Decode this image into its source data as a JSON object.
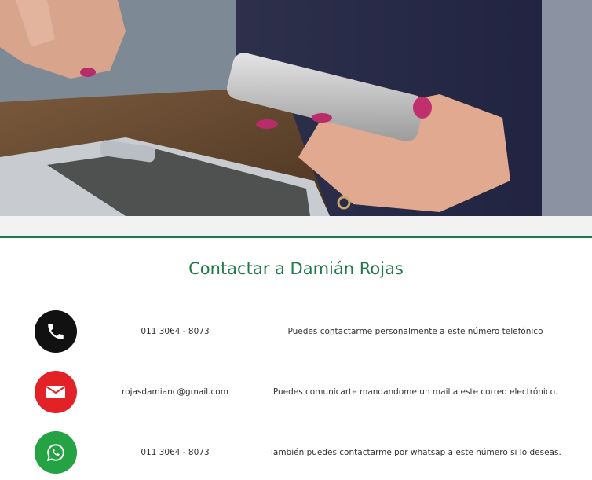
{
  "title": "Contactar a Damián Rojas",
  "colors": {
    "accent": "#1f7a48",
    "phone": "#111111",
    "mail": "#e32227",
    "whatsapp": "#25a244"
  },
  "contacts": [
    {
      "icon": "phone-icon",
      "value": "011 3064 - 8073",
      "description": "Puedes contactarme personalmente a este número telefónico"
    },
    {
      "icon": "mail-icon",
      "value": "rojasdamianc@gmail.com",
      "description": "Puedes comunicarte mandandome un mail a este correo electrónico."
    },
    {
      "icon": "whatsapp-icon",
      "value": "011 3064 - 8073",
      "description": "También puedes contactarme por whatsap a este número si lo deseas."
    }
  ]
}
